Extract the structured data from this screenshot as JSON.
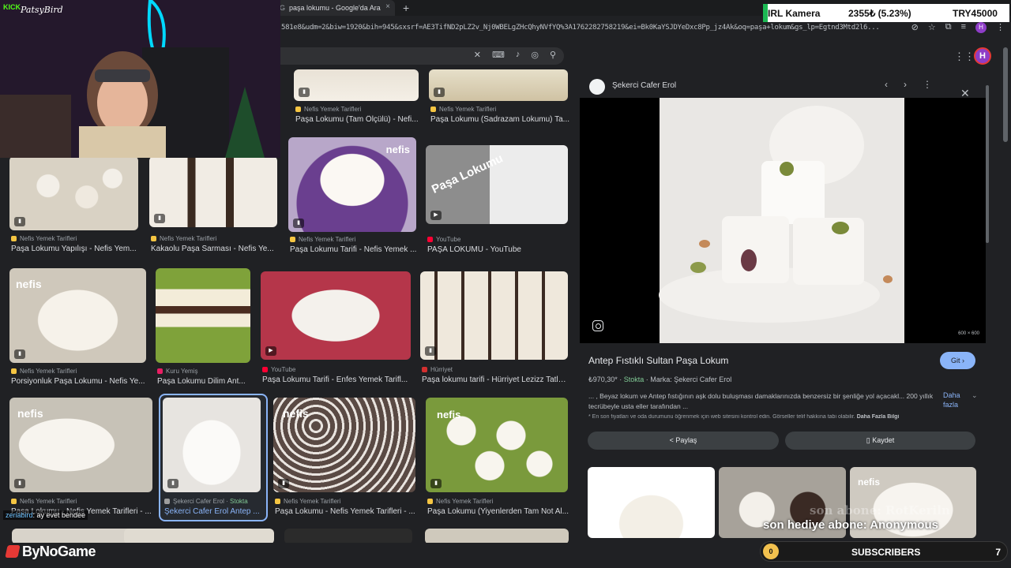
{
  "browser": {
    "tab_title": "paşa lokumu - Google'da Ara",
    "new_tab": "+",
    "url": "581e8&udm=2&biw=1920&bih=945&sxsrf=AE3TifND2pLZ2v_Nj0WBELgZHcQhyNVfYQ%3A1762282758219&ei=Bk0KaYSJDYeDxc8Pp_jz4Ak&oq=paşa+lokum&gs_lp=Egtnd3Mtd2l6...",
    "profile_initial": "H"
  },
  "google": {
    "profile_initial": "H",
    "grid": [
      {
        "source": "Nefis Yemek Tarifleri",
        "title": "Paşa Lokumu (Tam Ölçülü) - Nefi...",
        "fav": "#f5c542"
      },
      {
        "source": "Nefis Yemek Tarifleri",
        "title": "Paşa Lokumu (Sadrazam Lokumu) Ta...",
        "fav": "#f5c542"
      },
      {
        "source": "Nefis Yemek Tarifleri",
        "title": "Paşa Lokumu Yapılışı - Nefis Yem...",
        "fav": "#f5c542"
      },
      {
        "source": "Nefis Yemek Tarifleri",
        "title": "Kakaolu Paşa Sarması - Nefis Ye...",
        "fav": "#f5c542"
      },
      {
        "source": "Nefis Yemek Tarifleri",
        "title": "Paşa Lokumu Tarifi - Nefis Yemek ...",
        "fav": "#f5c542"
      },
      {
        "source": "YouTube",
        "title": "PAŞA LOKUMU - YouTube",
        "fav": "#ff0033"
      },
      {
        "source": "Nefis Yemek Tarifleri",
        "title": "Porsiyonluk Paşa Lokumu - Nefis Ye...",
        "fav": "#f5c542"
      },
      {
        "source": "Kuru Yemiş",
        "title": "Paşa Lokumu Dilim Ant...",
        "fav": "#e91e63"
      },
      {
        "source": "YouTube",
        "title": "Paşa Lokumu Tarifi - Enfes Yemek Tarifl...",
        "fav": "#ff0033"
      },
      {
        "source": "Hürriyet",
        "title": "Paşa lokumu tarifi - Hürriyet Lezizz Tatlı ...",
        "fav": "#d32f2f"
      },
      {
        "source": "Nefis Yemek Tarifleri",
        "title": "Paşa Lokumu - Nefis Yemek Tarifleri - ...",
        "fav": "#f5c542"
      },
      {
        "source": "Şekerci Cafer Erol",
        "source_extra": "Stokta",
        "title": "Şekerci Cafer Erol Antep ...",
        "fav": "#9e9e9e"
      },
      {
        "source": "Nefis Yemek Tarifleri",
        "title": "Paşa Lokumu - Nefis Yemek Tarifleri - ...",
        "fav": "#f5c542"
      },
      {
        "source": "Nefis Yemek Tarifleri",
        "title": "Paşa Lokumu (Yiyenlerden Tam Not Al...",
        "fav": "#f5c542"
      }
    ],
    "thumb_overlay_texts": [
      "nefis",
      "Paşa Lokumu"
    ]
  },
  "preview": {
    "site": "Şekerci Cafer Erol",
    "image_dims": "600 × 600",
    "title": "Antep Fıstıklı Sultan Paşa Lokum",
    "visit_label": "Git",
    "price": "₺970,30*",
    "stock": "Stokta",
    "brand": "Marka: Şekerci Cafer Erol",
    "description": "... , Beyaz lokum ve Antep fıstığının aşk dolu buluşması damaklarınızda benzersiz bir şenliğe yol açacakl... 200 yıllık tecrübeyle usta eller tarafından ...",
    "more_label": "Daha fazla",
    "note": "* En son fiyatları ve oda durumunu öğrenmek için web sitesini kontrol edin. Görseller telif hakkına tabi olabilir.",
    "note_link": "Daha Fazla Bilgi",
    "share_label": "Paylaş",
    "save_label": "Kaydet"
  },
  "overlay": {
    "kick_logo": "KICK",
    "streamer": "PatsyBird",
    "ticker_label": "IRL Kamera",
    "ticker_value": "2355₺ (5.23%)",
    "ticker_goal": "TRY45000",
    "chat_user": "zeriabird",
    "chat_message": ": ay evet bendee",
    "sponsor": "ByNoGame",
    "sub_count": "0",
    "sub_label": "SUBSCRIBERS",
    "sub_goal": "7",
    "sub_note": "son hediye abone: Anonymous",
    "ghost_text": "son abone: RotKeriln"
  }
}
